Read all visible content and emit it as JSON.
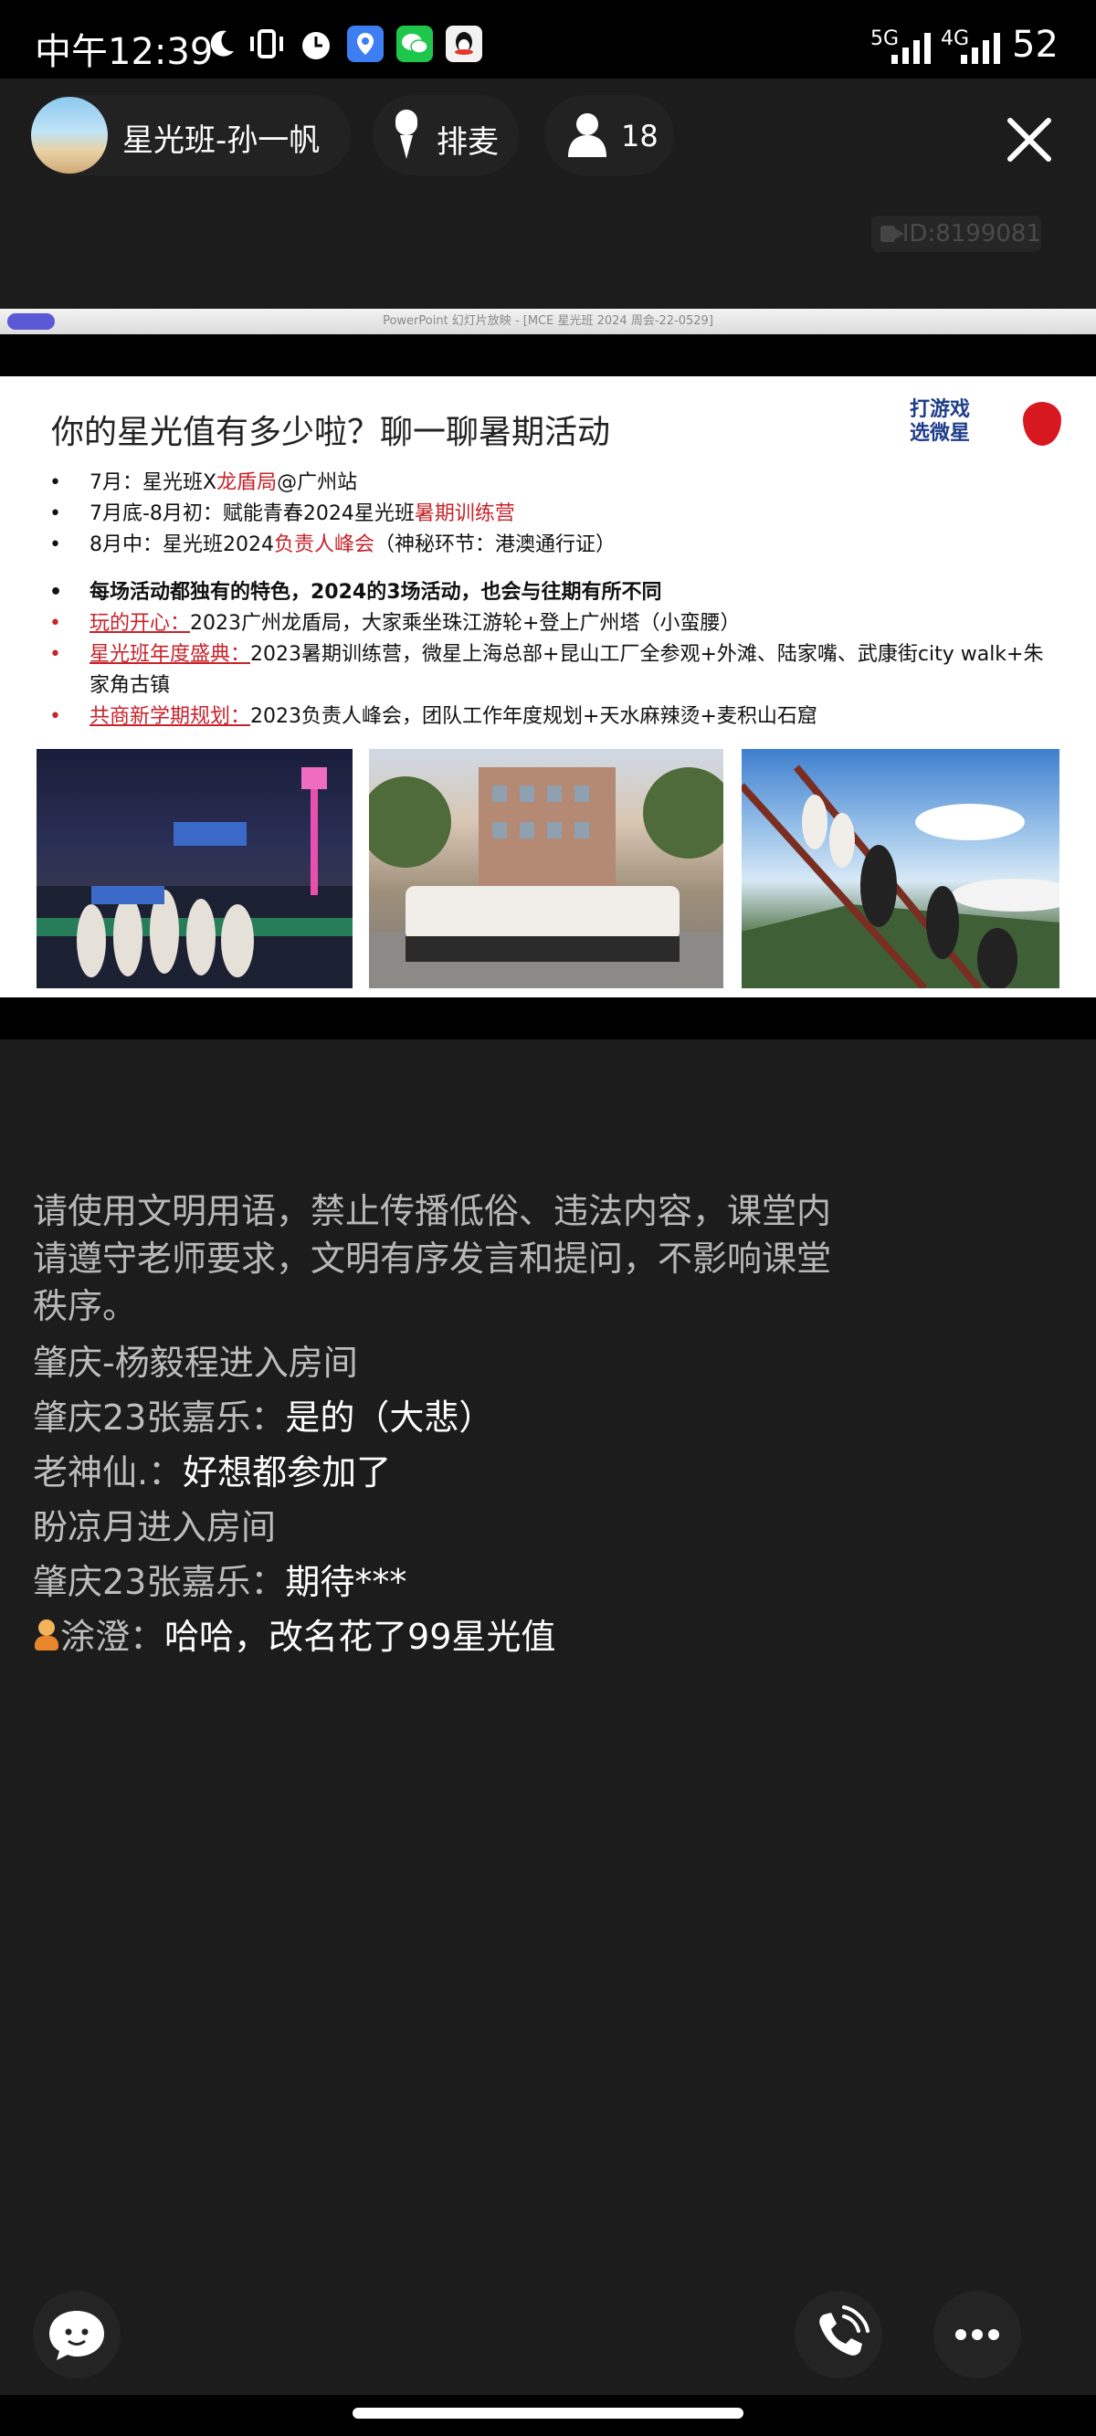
{
  "status_bar": {
    "time": "中午12:39",
    "icons": [
      "moon-icon",
      "vibrate-icon",
      "alarm-icon",
      "map-app-icon",
      "wechat-icon",
      "qq-icon"
    ],
    "network_1": "5G",
    "network_2": "4G",
    "battery": "52"
  },
  "room": {
    "host_name": "星光班-孙一帆",
    "mic_queue_label": "排麦",
    "viewer_count": "18",
    "room_id": "ID:8199081"
  },
  "slide": {
    "ppt_window_title": "PowerPoint 幻灯片放映 - [MCE 星光班 2024 周会-22-0529]",
    "title": "你的星光值有多少啦？聊一聊暑期活动",
    "logo_text_line1": "打游戏",
    "logo_text_line2": "选微星",
    "schedule": [
      {
        "prefix": "7月：星光班X",
        "highlight": "龙盾局",
        "suffix": "@广州站"
      },
      {
        "prefix": "7月底-8月初：赋能青春2024星光班",
        "highlight": "暑期训练营",
        "suffix": ""
      },
      {
        "prefix": "8月中：星光班2024",
        "highlight": "负责人峰会",
        "suffix": "（神秘环节：港澳通行证）"
      }
    ],
    "summary": "每场活动都独有的特色，2024的3场活动，也会与往期有所不同",
    "features": [
      {
        "label": "玩的开心：",
        "text": "2023广州龙盾局，大家乘坐珠江游轮+登上广州塔（小蛮腰）"
      },
      {
        "label": "星光班年度盛典：",
        "text": "2023暑期训练营，微星上海总部+昆山工厂全参观+外滩、陆家嘴、武康街city walk+朱家角古镇"
      },
      {
        "label": "共商新学期规划：",
        "text": "2023负责人峰会，团队工作年度规划+天水麻辣烫+麦积山石窟"
      }
    ]
  },
  "chat": {
    "notice": "请使用文明用语，禁止传播低俗、违法内容，课堂内请遵守老师要求，文明有序发言和提问，不影响课堂秩序。",
    "messages": [
      {
        "who": "肇庆-杨毅程进入房间",
        "text": ""
      },
      {
        "who": "肇庆23张嘉乐：",
        "text": "是的（大悲）"
      },
      {
        "who": "老神仙.：",
        "text": "好想都参加了"
      },
      {
        "who": "盼凉月进入房间",
        "text": ""
      },
      {
        "who": "肇庆23张嘉乐：",
        "text": "期待***"
      },
      {
        "who": "涂澄：",
        "text": "哈哈，改名花了99星光值"
      }
    ]
  }
}
